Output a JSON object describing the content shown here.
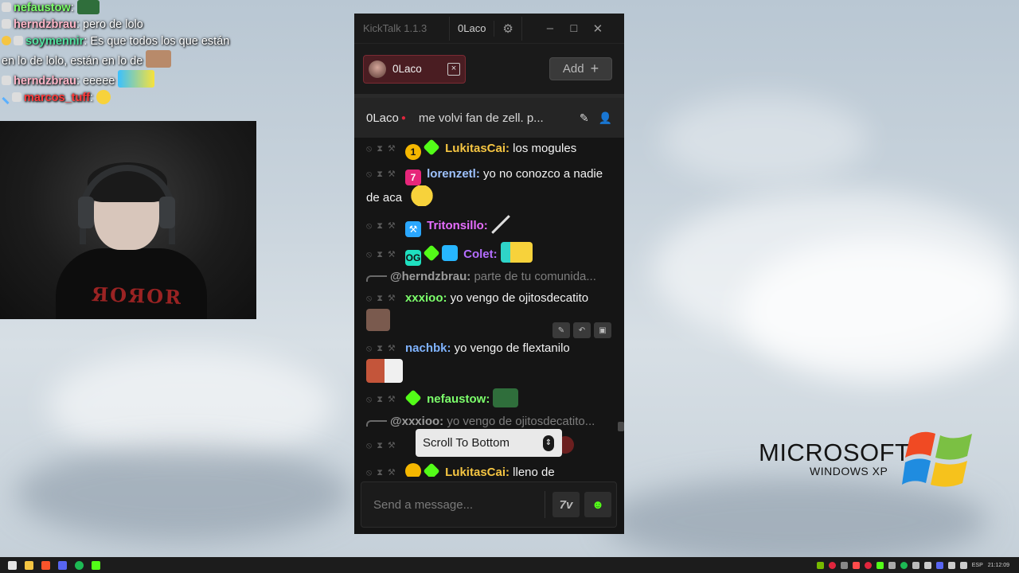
{
  "overlay_chat": [
    {
      "user": "nefaustow",
      "user_color": "#7cff6b",
      "text": ""
    },
    {
      "user": "herndzbrau",
      "user_color": "#ffb6c8",
      "text": " pero de lolo"
    },
    {
      "user": "soymennir",
      "user_color": "#52e2a1",
      "text": " Es que todos los que están"
    },
    {
      "user": "",
      "user_color": "#ffffff",
      "text": "en lo de lolo, están en lo de"
    },
    {
      "user": "herndzbrau",
      "user_color": "#ffb6c8",
      "text": " eeeee"
    },
    {
      "user": "marcos_tuff",
      "user_color": "#ff3b3b",
      "text": ""
    }
  ],
  "webcam": {
    "shirt_text": "ЯOЯOR"
  },
  "kicktalk": {
    "title": "KickTalk 1.1.3",
    "user": "0Laco",
    "tab": {
      "name": "0Laco",
      "close": "×"
    },
    "add_label": "Add",
    "add_icon": "+",
    "channel": {
      "name": "0Laco",
      "pinned": "me volvi fan de zell. p..."
    },
    "messages": [
      {
        "user": "LukitasCai:",
        "color": "#f5c542",
        "text": " los mogules"
      },
      {
        "user": "lorenzetl:",
        "color": "#9ec2ff",
        "text": " yo no conozco a nadie de aca"
      },
      {
        "user": "Tritonsillo:",
        "color": "#e66dff",
        "text": ""
      },
      {
        "user": "Colet:",
        "color": "#b46dff",
        "text": ""
      },
      {
        "reply_user": "@herndzbrau:",
        "reply_text": " parte de tu comunida..."
      },
      {
        "user": "xxxioo:",
        "color": "#7cff6b",
        "text": " yo vengo de ojitosdecatito"
      },
      {
        "user": "nachbk:",
        "color": "#7fb3ff",
        "text": " yo vengo de flextanilo"
      },
      {
        "user": "nefaustow:",
        "color": "#7cff6b",
        "text": ""
      },
      {
        "reply_user": "@xxxioo:",
        "reply_text": " yo vengo de ojitosdecatito..."
      },
      {
        "user": "LukitasCai:",
        "color": "#f5c542",
        "text": " lleno de"
      }
    ],
    "scroll_to_bottom": "Scroll To Bottom",
    "input_placeholder": "Send a message...",
    "emote_btn_1": "7v",
    "emote_btn_2": "☻"
  },
  "xp_logo": {
    "microsoft": "MICROSOFT",
    "windows": "WINDOWS XP"
  },
  "taskbar": {
    "lang": "ESP",
    "time": "21:12:09"
  }
}
